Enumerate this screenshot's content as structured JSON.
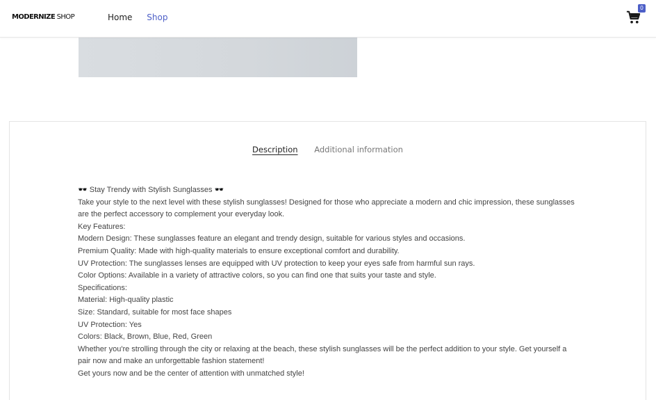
{
  "header": {
    "logo_bold": "MODERNIZE",
    "logo_light": " SHOP",
    "nav": [
      {
        "label": "Home"
      },
      {
        "label": "Shop"
      }
    ],
    "cart_count": "0",
    "accent_color": "#4d5fc7"
  },
  "product_image": {
    "icon": "product-image-placeholder"
  },
  "tabs": [
    {
      "label": "Description",
      "active": true
    },
    {
      "label": "Additional information",
      "active": false
    }
  ],
  "description": {
    "lines": [
      "🕶️ Stay Trendy with Stylish Sunglasses 🕶️",
      "Take your style to the next level with these stylish sunglasses! Designed for those who appreciate a modern and chic impression, these sunglasses are the perfect accessory to complement your everyday look.",
      "Key Features:",
      "Modern Design: These sunglasses feature an elegant and trendy design, suitable for various styles and occasions.",
      "Premium Quality: Made with high-quality materials to ensure exceptional comfort and durability.",
      "UV Protection: The sunglasses lenses are equipped with UV protection to keep your eyes safe from harmful sun rays.",
      "Color Options: Available in a variety of attractive colors, so you can find one that suits your taste and style.",
      "Specifications:",
      "Material: High-quality plastic",
      "Size: Standard, suitable for most face shapes",
      "UV Protection: Yes",
      "Colors: Black, Brown, Blue, Red, Green",
      "Whether you're strolling through the city or relaxing at the beach, these stylish sunglasses will be the perfect addition to your style. Get yourself a pair now and make an unforgettable fashion statement!",
      "Get yours now and be the center of attention with unmatched style!"
    ]
  }
}
